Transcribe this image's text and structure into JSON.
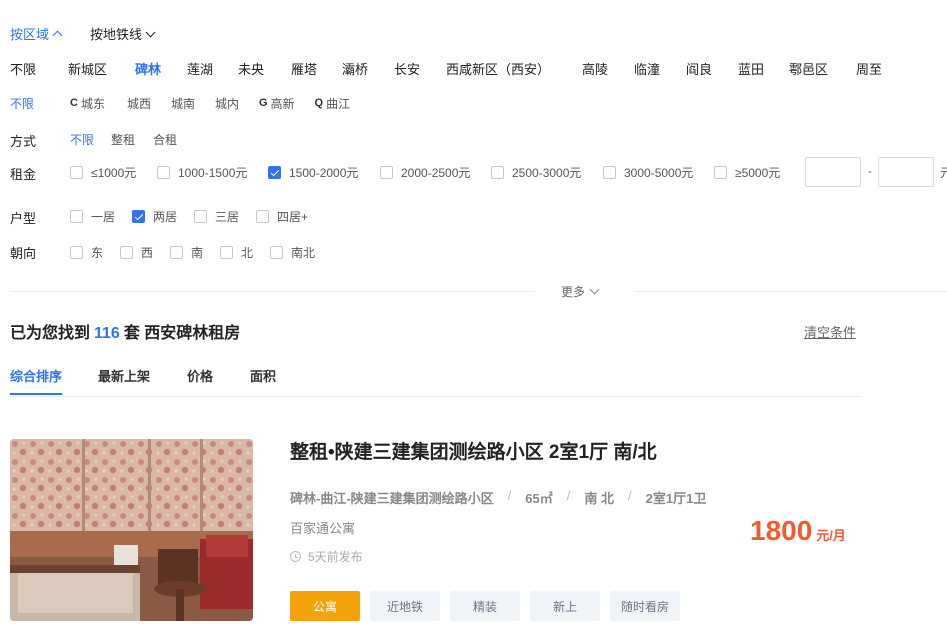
{
  "filter_tabs": {
    "by_district": "按区域",
    "by_subway": "按地铁线"
  },
  "districts": [
    "不限",
    "新城区",
    "碑林",
    "莲湖",
    "未央",
    "雁塔",
    "灞桥",
    "长安",
    "西咸新区（西安）",
    "高陵",
    "临潼",
    "阎良",
    "蓝田",
    "鄠邑区",
    "周至"
  ],
  "active_district": "碑林",
  "sub_districts": {
    "unlimited": "不限",
    "letter_c": "C",
    "city_east": "城东",
    "city_west": "城西",
    "city_south": "城南",
    "city_inner": "城内",
    "letter_g": "G",
    "gaoxin": "高新",
    "letter_q": "Q",
    "qujiang": "曲江"
  },
  "mode": {
    "label": "方式",
    "options": [
      "不限",
      "整租",
      "合租"
    ],
    "active": "不限"
  },
  "rent": {
    "label": "租金",
    "options": [
      "≤1000元",
      "1000-1500元",
      "1500-2000元",
      "2000-2500元",
      "2500-3000元",
      "3000-5000元",
      "≥5000元"
    ],
    "checked": [
      false,
      false,
      true,
      false,
      false,
      false,
      false
    ],
    "range_sep": "-",
    "unit": "元"
  },
  "layout": {
    "label": "户型",
    "options": [
      "一居",
      "两居",
      "三居",
      "四居+"
    ],
    "checked": [
      false,
      true,
      false,
      false
    ]
  },
  "orientation": {
    "label": "朝向",
    "options": [
      "东",
      "西",
      "南",
      "北",
      "南北"
    ],
    "checked": [
      false,
      false,
      false,
      false,
      false
    ]
  },
  "more_label": "更多",
  "results": {
    "prefix": "已为您找到",
    "count": "116",
    "suffix": "套 西安碑林租房",
    "clear": "清空条件"
  },
  "sort_tabs": [
    "综合排序",
    "最新上架",
    "价格",
    "面积"
  ],
  "listing": {
    "title": "整租•陕建三建集团测绘路小区 2室1厅 南/北",
    "location": "碑林-曲江-陕建三建集团测绘路小区",
    "area": "65㎡",
    "direction": "南 北",
    "rooms": "2室1厅1卫",
    "separator": "/",
    "agency": "百家通公寓",
    "posted": "5天前发布",
    "price": "1800",
    "price_unit": "元/月",
    "tags": [
      "公寓",
      "近地铁",
      "精装",
      "新上",
      "随时看房"
    ]
  },
  "colors": {
    "accent": "#3072f6",
    "price": "#f25a30",
    "tag_primary": "#f6a20a"
  }
}
